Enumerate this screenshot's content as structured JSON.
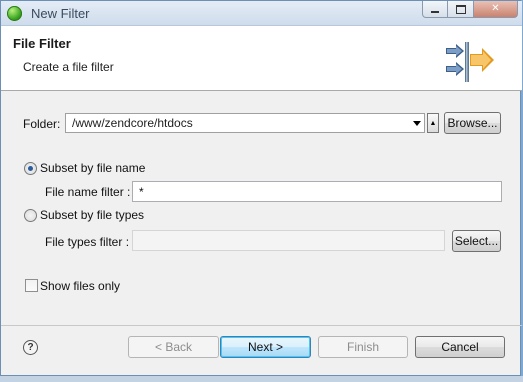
{
  "window": {
    "title": "New Filter",
    "controls": {
      "minimize": "▭",
      "maximize": "□",
      "close": "✕"
    }
  },
  "banner": {
    "title": "File Filter",
    "description": "Create a file filter",
    "icon": "filter-arrows-icon"
  },
  "folder": {
    "label": "Folder:",
    "value": "/www/zendcore/htdocs",
    "up_button": "▲",
    "browse_button": "Browse..."
  },
  "subset_by_name": {
    "label": "Subset by file name",
    "selected": true,
    "filter_label": "File name filter :",
    "filter_value": "*"
  },
  "subset_by_types": {
    "label": "Subset by file types",
    "selected": false,
    "filter_label": "File types filter :",
    "filter_value": "",
    "select_button": "Select..."
  },
  "show_files_only": {
    "label": "Show files only",
    "checked": false
  },
  "footer": {
    "help_icon": "?",
    "back_button": "< Back",
    "next_button": "Next >",
    "finish_button": "Finish",
    "cancel_button": "Cancel"
  },
  "colors": {
    "accent": "#3c7fb1",
    "title_bar": "#d6e2f0",
    "banner_bg": "#ffffff",
    "dialog_bg": "#f0f0f0"
  }
}
